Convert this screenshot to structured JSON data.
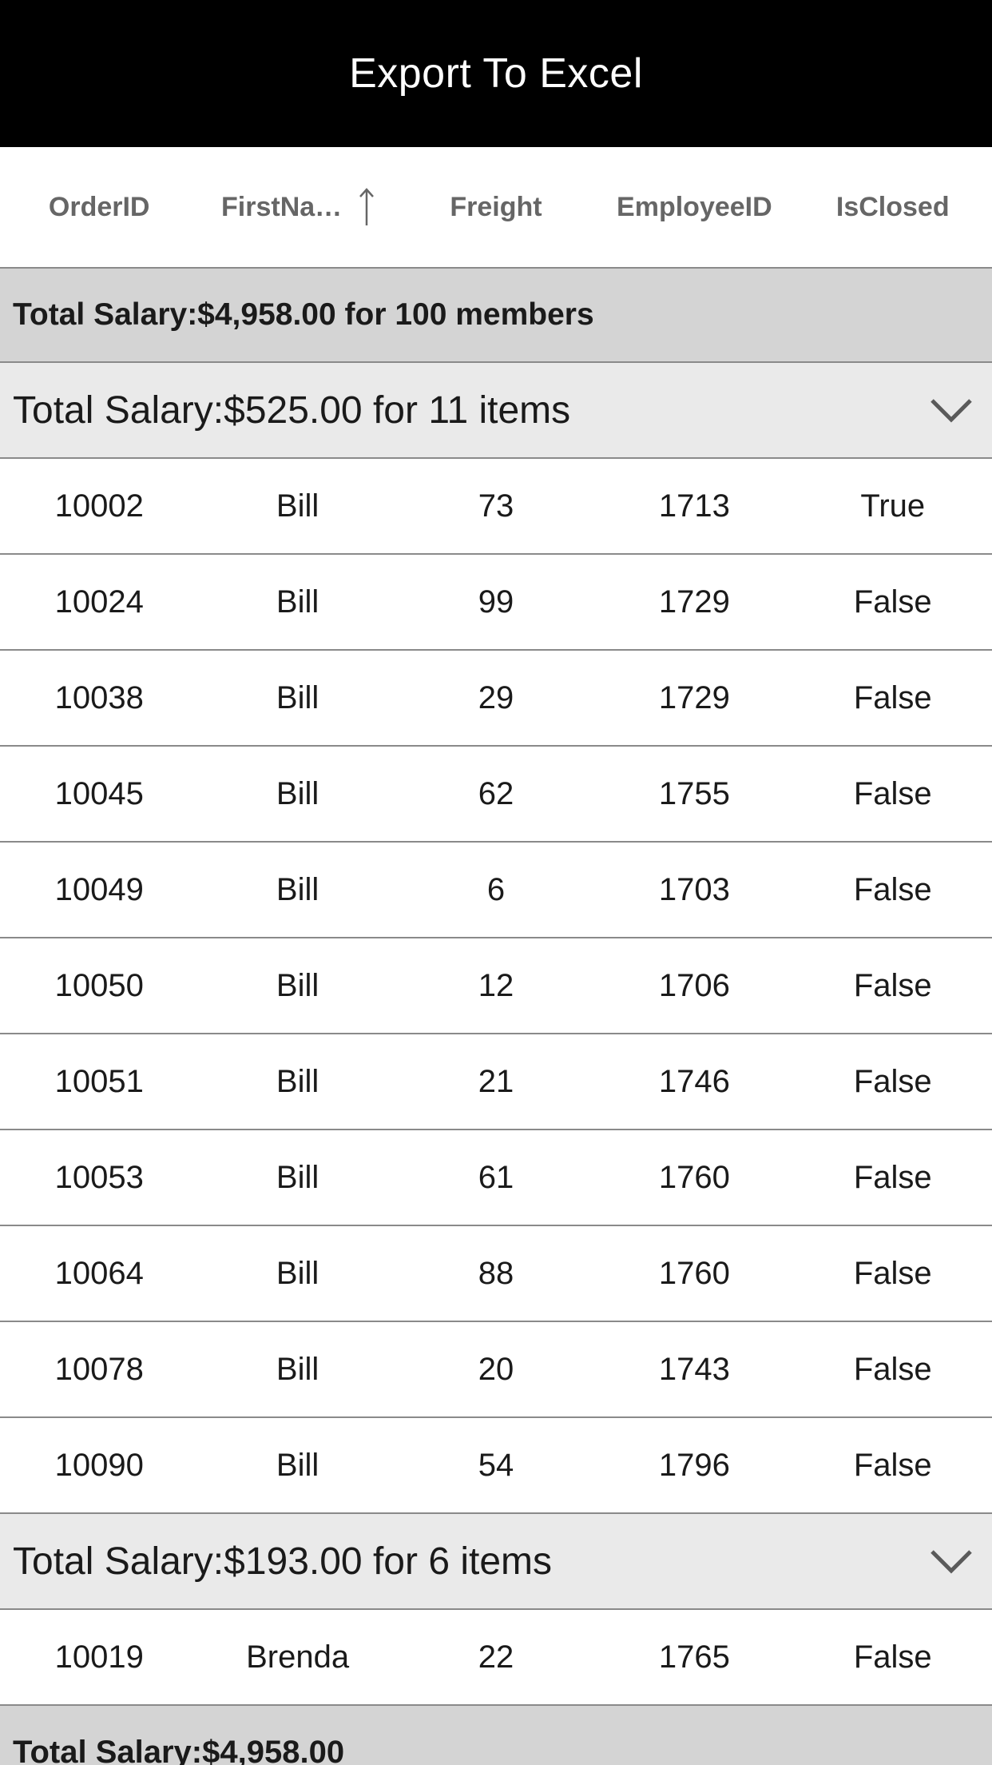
{
  "toolbar": {
    "export_label": "Export To Excel"
  },
  "columns": [
    {
      "label": "OrderID"
    },
    {
      "label": "FirstNa…",
      "sorted": "ascending",
      "sort_icon": "arrow-up-icon"
    },
    {
      "label": "Freight"
    },
    {
      "label": "EmployeeID"
    },
    {
      "label": "IsClosed"
    }
  ],
  "caption_summary": "Total Salary:$4,958.00 for 100 members",
  "groups": [
    {
      "caption": "Total Salary:$525.00 for 11 items",
      "expanded": true,
      "rows": [
        {
          "order_id": "10002",
          "first_name": "Bill",
          "freight": "73",
          "employee_id": "1713",
          "is_closed": "True"
        },
        {
          "order_id": "10024",
          "first_name": "Bill",
          "freight": "99",
          "employee_id": "1729",
          "is_closed": "False"
        },
        {
          "order_id": "10038",
          "first_name": "Bill",
          "freight": "29",
          "employee_id": "1729",
          "is_closed": "False"
        },
        {
          "order_id": "10045",
          "first_name": "Bill",
          "freight": "62",
          "employee_id": "1755",
          "is_closed": "False"
        },
        {
          "order_id": "10049",
          "first_name": "Bill",
          "freight": "6",
          "employee_id": "1703",
          "is_closed": "False"
        },
        {
          "order_id": "10050",
          "first_name": "Bill",
          "freight": "12",
          "employee_id": "1706",
          "is_closed": "False"
        },
        {
          "order_id": "10051",
          "first_name": "Bill",
          "freight": "21",
          "employee_id": "1746",
          "is_closed": "False"
        },
        {
          "order_id": "10053",
          "first_name": "Bill",
          "freight": "61",
          "employee_id": "1760",
          "is_closed": "False"
        },
        {
          "order_id": "10064",
          "first_name": "Bill",
          "freight": "88",
          "employee_id": "1760",
          "is_closed": "False"
        },
        {
          "order_id": "10078",
          "first_name": "Bill",
          "freight": "20",
          "employee_id": "1743",
          "is_closed": "False"
        },
        {
          "order_id": "10090",
          "first_name": "Bill",
          "freight": "54",
          "employee_id": "1796",
          "is_closed": "False"
        }
      ]
    },
    {
      "caption": "Total Salary:$193.00 for 6 items",
      "expanded": true,
      "rows": [
        {
          "order_id": "10019",
          "first_name": "Brenda",
          "freight": "22",
          "employee_id": "1765",
          "is_closed": "False"
        }
      ]
    }
  ],
  "table_summary": "Total Salary:$4,958.00",
  "icons": {
    "chevron": "chevron-down-icon",
    "sort": "arrow-up-icon"
  },
  "colors": {
    "toolbar_bg": "#000000",
    "caption_summary_bg": "#d4d4d4",
    "group_caption_bg": "#eaeaea",
    "header_text": "#666666",
    "grid_line": "#8a8a8a"
  }
}
